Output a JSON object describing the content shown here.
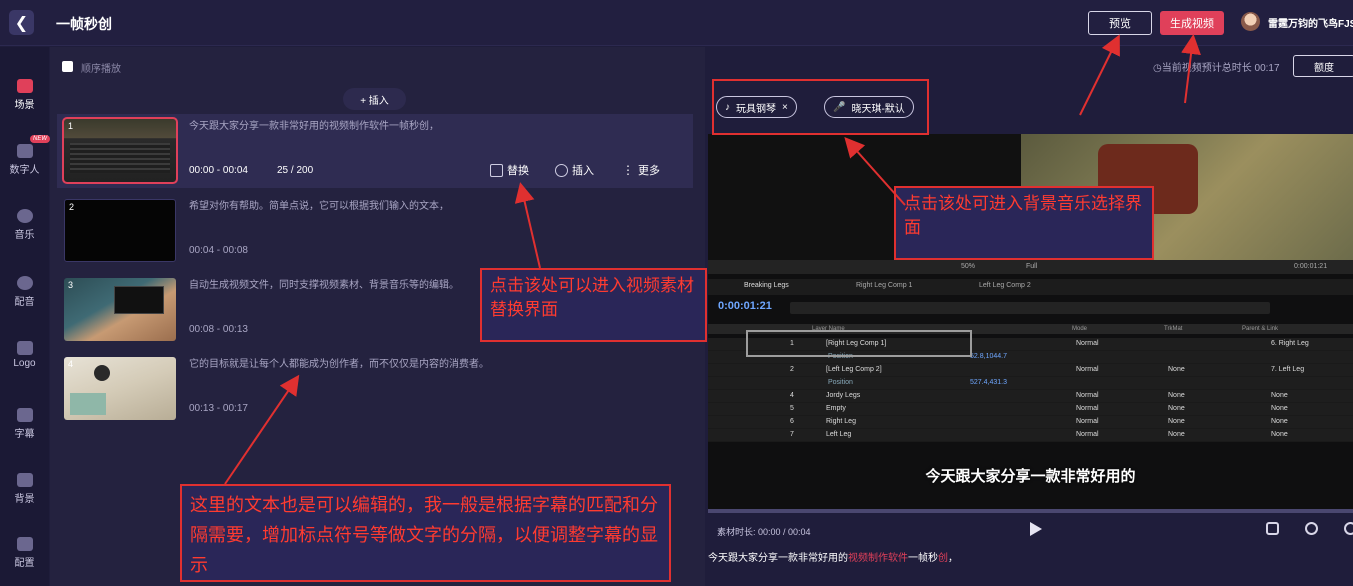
{
  "header": {
    "back_icon": "chevron-left-icon",
    "title": "一帧秒创",
    "preview_label": "预览",
    "generate_label": "生成视频",
    "user_name": "雷霆万钧的飞鸟FJS"
  },
  "sidebar": {
    "items": [
      {
        "label": "场景",
        "icon": "scene-icon",
        "active": true
      },
      {
        "label": "数字人",
        "icon": "avatar-icon",
        "badge": "NEW"
      },
      {
        "label": "音乐",
        "icon": "music-icon"
      },
      {
        "label": "配音",
        "icon": "voiceover-icon"
      },
      {
        "label": "Logo",
        "icon": "logo-icon"
      },
      {
        "label": "字幕",
        "icon": "subtitle-icon"
      },
      {
        "label": "背景",
        "icon": "background-icon"
      },
      {
        "label": "配置",
        "icon": "settings-icon"
      }
    ]
  },
  "scenes": {
    "sequential_label": "顺序播放",
    "insert_top_label": "+ 插入",
    "items": [
      {
        "num": "1",
        "text": "今天跟大家分享一款非常好用的视频制作软件一帧秒创，",
        "time": "00:00 - 00:04",
        "count": "25 / 200"
      },
      {
        "num": "2",
        "text": "希望对你有帮助。简单点说，它可以根据我们输入的文本，",
        "time": "00:04 - 00:08"
      },
      {
        "num": "3",
        "text": "自动生成视频文件，同时支撑视频素材、背景音乐等的编辑。",
        "time": "00:08 - 00:13"
      },
      {
        "num": "4",
        "text": "它的目标就是让每个人都能成为创作者，而不仅仅是内容的消费者。",
        "time": "00:13 - 00:17"
      }
    ],
    "actions": {
      "replace": "替换",
      "insert": "插入",
      "more": "更多"
    }
  },
  "preview": {
    "total_time": "当前视频预计总时长 00:17",
    "quota_label": "额度",
    "music_chip": "玩具钢琴",
    "voice_chip": "晓天琪-默认",
    "ae": {
      "zoom": "50%",
      "res": "Full",
      "time_small": "0:00:01:21",
      "tabs": [
        "Breaking Legs",
        "Right Leg Comp 1",
        "Left Leg Comp 2"
      ],
      "timecode": "0:00:01:21",
      "header": {
        "layer_name": "Layer Name",
        "mode": "Mode",
        "trkmat": "TrkMat",
        "parent": "Parent & Link"
      },
      "layers": [
        {
          "n": "1",
          "name": "[Right Leg Comp 1]",
          "mode": "Normal",
          "trk": "",
          "parent": "6. Right Leg"
        },
        {
          "n": "",
          "name": "Position",
          "value": "52.8,1044.7"
        },
        {
          "n": "2",
          "name": "[Left Leg Comp 2]",
          "mode": "Normal",
          "trk": "None",
          "parent": "7. Left Leg"
        },
        {
          "n": "",
          "name": "Position",
          "value": "527.4,431.3"
        },
        {
          "n": "4",
          "name": "Jordy Legs",
          "mode": "Normal",
          "trk": "None",
          "parent": "None"
        },
        {
          "n": "5",
          "name": "Empty",
          "mode": "Normal",
          "trk": "None",
          "parent": "None"
        },
        {
          "n": "6",
          "name": "Right Leg",
          "mode": "Normal",
          "trk": "None",
          "parent": "None"
        },
        {
          "n": "7",
          "name": "Left Leg",
          "mode": "Normal",
          "trk": "None",
          "parent": "None"
        }
      ]
    },
    "overlay_subtitle": "今天跟大家分享一款非常好用的",
    "material_time": "素材时长: 00:00 / 00:04",
    "sub_line": {
      "a": "今天跟大家分享一款非常好用的",
      "b": "视频制作软件",
      "c": "一帧秒",
      "d": "创",
      "e": "，"
    }
  },
  "annotations": {
    "bgm_note": "点击该处可进入背景音乐选择界面",
    "replace_note": "点击该处可以进入视频素材替换界面",
    "text_note": "这里的文本也是可以编辑的，我一般是根据字幕的匹配和分隔需要，增加标点符号等做文字的分隔，以便调整字幕的显示"
  },
  "colors": {
    "accent": "#e0405a",
    "annotation": "#e03030"
  }
}
